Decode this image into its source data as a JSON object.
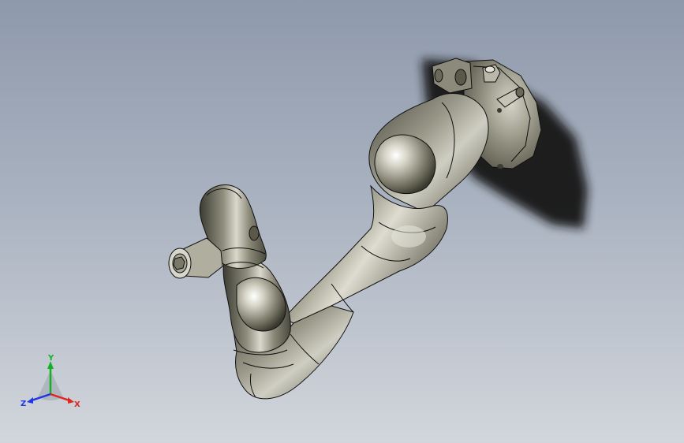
{
  "viewport": {
    "background_top": "#8e99ab",
    "background_bottom": "#d2d6dc"
  },
  "model": {
    "body_color": "#7d7c6c",
    "highlight_color": "#f4f4ec",
    "edge_color": "#101010",
    "shadow_color": "#161616"
  },
  "triad": {
    "x_label": "X",
    "y_label": "Y",
    "z_label": "Z",
    "x_color": "#e0261f",
    "y_color": "#14b02a",
    "z_color": "#1f36e6"
  }
}
